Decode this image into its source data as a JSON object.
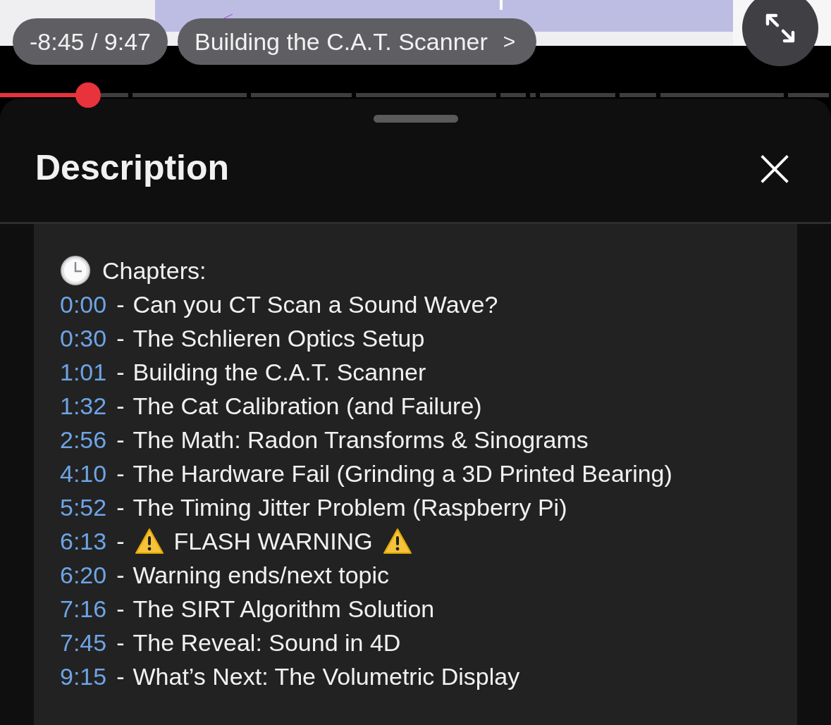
{
  "player": {
    "kind": "picture",
    "time": "-8:45 / 9:47",
    "chapter": "Building the C.A.T. Scanner",
    "chapter_arrow": ">",
    "progress": {
      "level": 0.106
    }
  },
  "sheet": {
    "title": "Description",
    "close": "×",
    "chapters_heading": "Chapters:",
    "chapters": [
      {
        "time": "0:00",
        "sep": "-",
        "title": "Can you CT Scan a Sound Wave?",
        "kind": "plain"
      },
      {
        "time": "0:30",
        "sep": "-",
        "title": "The Schlieren Optics Setup",
        "kind": "plain"
      },
      {
        "time": "1:01",
        "sep": "-",
        "title": "Building the C.A.T. Scanner",
        "kind": "plain"
      },
      {
        "time": "1:32",
        "sep": "-",
        "title": "The Cat Calibration (and Failure)",
        "kind": "plain"
      },
      {
        "time": "2:56",
        "sep": "-",
        "title": "The Math: Radon Transforms & Sinograms",
        "kind": "plain"
      },
      {
        "time": "4:10",
        "sep": "-",
        "title": "The Hardware Fail (Grinding a 3D Printed Bearing)",
        "kind": "plain"
      },
      {
        "time": "5:52",
        "sep": "-",
        "title": "The Timing Jitter Problem (Raspberry Pi)",
        "kind": "plain"
      },
      {
        "time": "6:13",
        "sep": "-",
        "title": "FLASH WARNING",
        "kind": "warning"
      },
      {
        "time": "6:20",
        "sep": "-",
        "title": "Warning ends/next topic",
        "kind": "plain"
      },
      {
        "time": "7:16",
        "sep": "-",
        "title": "The SIRT Algorithm Solution",
        "kind": "plain"
      },
      {
        "time": "7:45",
        "sep": "-",
        "title": "The Reveal: Sound in 4D",
        "kind": "plain"
      },
      {
        "time": "9:15",
        "sep": "-",
        "title": "What’s Next: The Volumetric Display",
        "kind": "plain"
      }
    ]
  }
}
